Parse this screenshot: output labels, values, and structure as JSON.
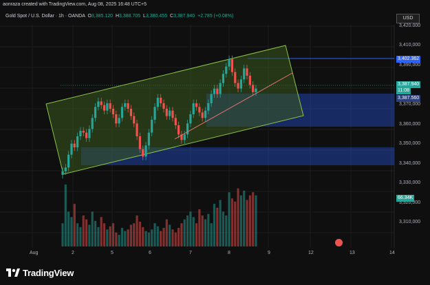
{
  "topbar": {
    "author_label": "aonraza created with TradingView.com, Aug 08, 2025 16:48 UTC+5"
  },
  "header": {
    "symbol": "Gold Spot / U.S. Dollar · 1h · OANDA",
    "open_key": "O",
    "open": "3,385.120",
    "high_key": "H",
    "high": "3,388.705",
    "low_key": "L",
    "low": "3,380.455",
    "close_key": "C",
    "close": "3,387.940",
    "change": "+2.785 (+0.08%)",
    "currency_button": "USD"
  },
  "price_axis": {
    "ticks": [
      "3,420.000",
      "3,410,000",
      "3,390,000",
      "3,380,000",
      "3,370,000",
      "3,360,000",
      "3,350,000",
      "3,340,000",
      "3,330,000",
      "3,320,000",
      "3,310,000"
    ],
    "tag_high": "3,402.362",
    "tag_current_price": "3,387.940",
    "tag_current_time": "11:08",
    "tag_low": "3,387.560",
    "tag_volume": "66.34K"
  },
  "time_axis": {
    "labels": [
      "Aug",
      "2",
      "5",
      "6",
      "7",
      "8",
      "9",
      "12",
      "13",
      "14"
    ]
  },
  "colors": {
    "bull": "#26a69a",
    "bear": "#ef5350",
    "channel_fill": "#3a5a1f",
    "channel_border": "#8bc34a",
    "zone_blue": "#2962ff",
    "trendline": "#e57373"
  },
  "footer": {
    "brand": "TradingView"
  },
  "chart_data": {
    "type": "candlestick",
    "symbol": "Gold Spot / U.S. Dollar",
    "interval": "1h",
    "ylim": [
      3305,
      3422
    ],
    "x_labels": [
      "Aug",
      "2",
      "5",
      "6",
      "7",
      "8",
      "9",
      "12",
      "13",
      "14"
    ],
    "series": [
      {
        "name": "",
        "close": [
          3343,
          3345,
          3352,
          3358,
          3356,
          3362,
          3365,
          3364,
          3361,
          3366,
          3372,
          3378,
          3381,
          3379,
          3376,
          3380,
          3377,
          3374,
          3369,
          3372,
          3378,
          3380,
          3377,
          3373,
          3369,
          3362,
          3355,
          3351,
          3357,
          3364,
          3371,
          3378,
          3383,
          3380,
          3377,
          3373,
          3376,
          3372,
          3368,
          3363,
          3360,
          3363,
          3369,
          3374,
          3380,
          3378,
          3375,
          3372,
          3376,
          3380,
          3385,
          3388,
          3385,
          3391,
          3396,
          3400,
          3404,
          3397,
          3391,
          3388,
          3393,
          3399,
          3395,
          3390,
          3386,
          3388
        ],
        "volume": [
          30,
          80,
          45,
          38,
          55,
          30,
          25,
          40,
          35,
          28,
          45,
          33,
          25,
          38,
          30,
          22,
          26,
          30,
          18,
          15,
          24,
          20,
          22,
          28,
          30,
          40,
          32,
          25,
          20,
          18,
          22,
          30,
          26,
          20,
          24,
          35,
          28,
          22,
          18,
          24,
          30,
          35,
          40,
          45,
          38,
          30,
          48,
          40,
          35,
          42,
          30,
          55,
          50,
          60,
          45,
          40,
          70,
          62,
          58,
          75,
          66,
          72,
          60,
          66,
          70,
          66
        ]
      }
    ]
  }
}
